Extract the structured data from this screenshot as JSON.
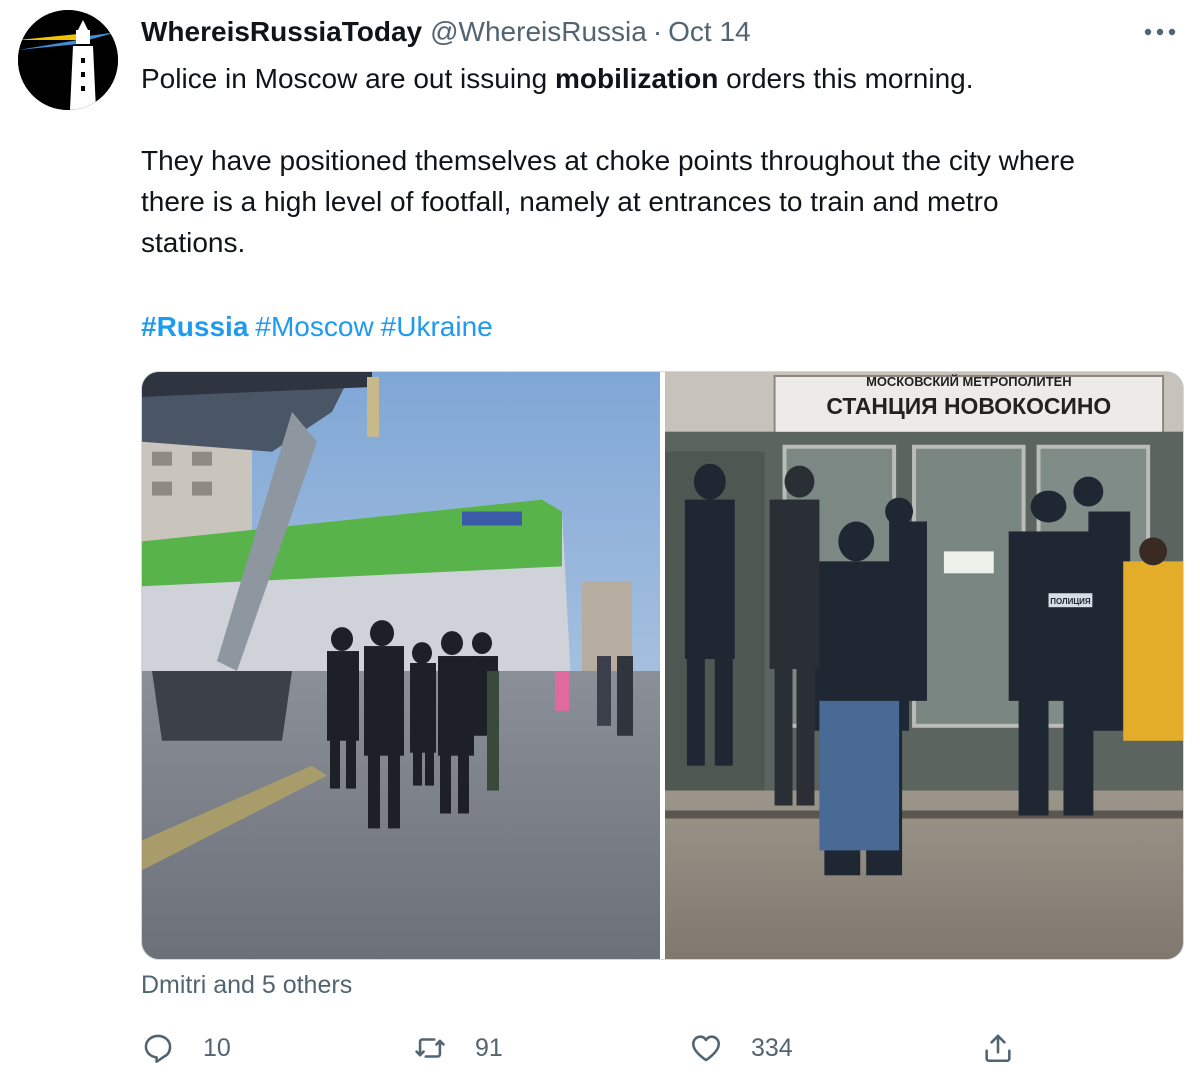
{
  "author": {
    "display_name": "WhereisRussiaToday",
    "handle": "@WhereisRussia",
    "separator": "·",
    "date": "Oct 14",
    "avatar_icon": "lighthouse-icon"
  },
  "tweet": {
    "line1_before": "Police in Moscow are out issuing ",
    "line1_bold": "mobilization",
    "line1_after": " orders this morning.",
    "para2_line1": "They have positioned themselves at choke points throughout the city where",
    "para2_line2": "there is a high level of footfall, namely at entrances to train and metro",
    "para2_line3": "stations."
  },
  "hashtags": [
    "#Russia",
    "#Moscow",
    "#Ukraine"
  ],
  "media": {
    "sign_line1": "МОСКОВСКИЙ МЕТРОПОЛИТЕН",
    "sign_line2": "СТАНЦИЯ НОВОКОСИНО",
    "patch_text": "ПОЛИЦИЯ"
  },
  "likers": "Dmitri and 5 others",
  "actions": {
    "reply_count": "10",
    "retweet_count": "91",
    "like_count": "334"
  },
  "colors": {
    "link": "#1d9bf0",
    "secondary_text": "#536471",
    "primary_text": "#0f1419",
    "border": "#cfd9de"
  }
}
